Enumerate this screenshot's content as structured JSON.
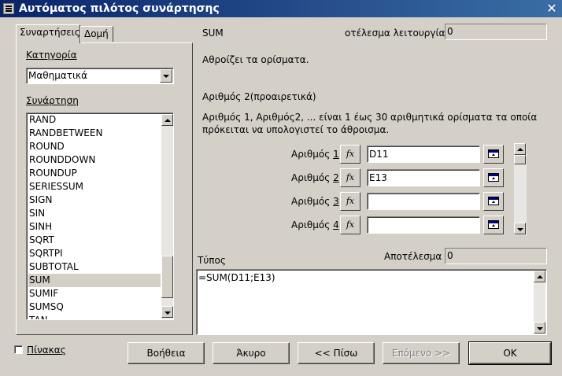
{
  "window": {
    "title": "Αυτόματος πιλότος συνάρτησης",
    "close_glyph": "✕"
  },
  "tabs": [
    {
      "label": "Συναρτήσεις",
      "active": true
    },
    {
      "label": "Δομή",
      "active": false
    }
  ],
  "category": {
    "label": "Κατηγορία",
    "value": "Μαθηματικά"
  },
  "function_list": {
    "label": "Συνάρτηση",
    "items": [
      "RAND",
      "RANDBETWEEN",
      "ROUND",
      "ROUNDDOWN",
      "ROUNDUP",
      "SERIESSUM",
      "SIGN",
      "SIN",
      "SINH",
      "SQRT",
      "SQRTPI",
      "SUBTOTAL",
      "SUM",
      "SUMIF",
      "SUMSQ",
      "TAN"
    ],
    "selected": "SUM"
  },
  "function_name": "SUM",
  "function_result": {
    "label": "οτέλεσμα λειτουργίας",
    "value": "0"
  },
  "description": "Αθροίζει τα ορίσματα.",
  "argument_title": "Αριθμός 2(προαιρετικά)",
  "argument_desc_line1": "Αριθμός 1, Αριθμός2, ... είναι 1 έως 30 αριθμητικά ορίσματα τα οποία",
  "argument_desc_line2": "πρόκειται να υπολογιστεί το άθροισμα.",
  "arguments": [
    {
      "label_prefix": "Αριθμός ",
      "label_num": "1",
      "value": "D11"
    },
    {
      "label_prefix": "Αριθμός ",
      "label_num": "2",
      "value": "E13"
    },
    {
      "label_prefix": "Αριθμός ",
      "label_num": "3",
      "value": ""
    },
    {
      "label_prefix": "Αριθμός ",
      "label_num": "4",
      "value": ""
    }
  ],
  "fx_label": "fx",
  "formula": {
    "label": "Τύπος",
    "value": "=SUM(D11;E13)"
  },
  "result": {
    "label": "Αποτέλεσμα",
    "value": "0"
  },
  "array_checkbox": {
    "label": "Πίνακας",
    "checked": false
  },
  "buttons": {
    "help": "Βοήθεια",
    "cancel": "Άκυρο",
    "back": "<< Πίσω",
    "next": "Επόμενο >>",
    "ok": "OK"
  }
}
